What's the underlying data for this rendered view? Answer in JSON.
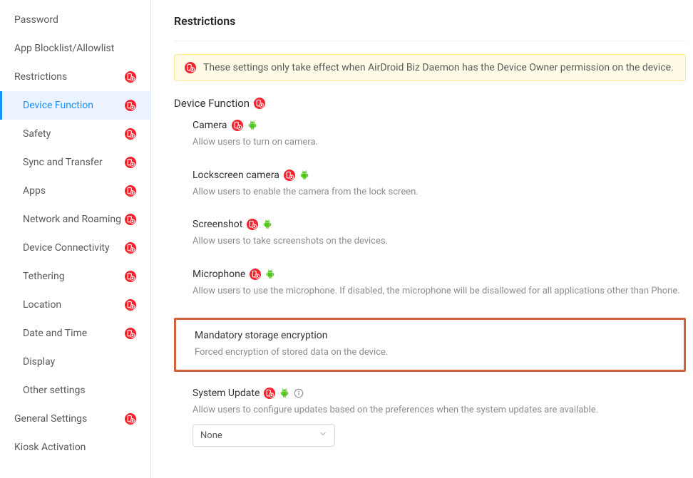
{
  "sidebar": {
    "items": [
      {
        "label": "Password",
        "badge": false,
        "sub": false
      },
      {
        "label": "App Blocklist/Allowlist",
        "badge": false,
        "sub": false
      },
      {
        "label": "Restrictions",
        "badge": true,
        "sub": false
      },
      {
        "label": "Device Function",
        "badge": true,
        "sub": true,
        "active": true
      },
      {
        "label": "Safety",
        "badge": true,
        "sub": true
      },
      {
        "label": "Sync and Transfer",
        "badge": true,
        "sub": true
      },
      {
        "label": "Apps",
        "badge": true,
        "sub": true
      },
      {
        "label": "Network and Roaming",
        "badge": true,
        "sub": true
      },
      {
        "label": "Device Connectivity",
        "badge": true,
        "sub": true
      },
      {
        "label": "Tethering",
        "badge": true,
        "sub": true
      },
      {
        "label": "Location",
        "badge": true,
        "sub": true
      },
      {
        "label": "Date and Time",
        "badge": true,
        "sub": true
      },
      {
        "label": "Display",
        "badge": false,
        "sub": true
      },
      {
        "label": "Other settings",
        "badge": false,
        "sub": true
      },
      {
        "label": "General Settings",
        "badge": true,
        "sub": false
      },
      {
        "label": "Kiosk Activation",
        "badge": false,
        "sub": false
      }
    ]
  },
  "page": {
    "title": "Restrictions",
    "notice": "These settings only take effect when AirDroid Biz Daemon has the Device Owner permission on the device.",
    "sectionHeading": "Device Function",
    "settings": {
      "camera": {
        "title": "Camera",
        "desc": "Allow users to turn on camera."
      },
      "lockscreen": {
        "title": "Lockscreen camera",
        "desc": "Allow users to enable the camera from the lock screen."
      },
      "screenshot": {
        "title": "Screenshot",
        "desc": "Allow users to take screenshots on the devices."
      },
      "microphone": {
        "title": "Microphone",
        "desc": "Allow users to use the microphone. If disabled, the microphone will be disallowed for all applications other than Phone."
      },
      "encryption": {
        "title": "Mandatory storage encryption",
        "desc": "Forced encryption of stored data on the device."
      },
      "systemUpdate": {
        "title": "System Update",
        "desc": "Allow users to configure updates based on the preferences when the system updates are available.",
        "selectValue": "None"
      }
    }
  }
}
